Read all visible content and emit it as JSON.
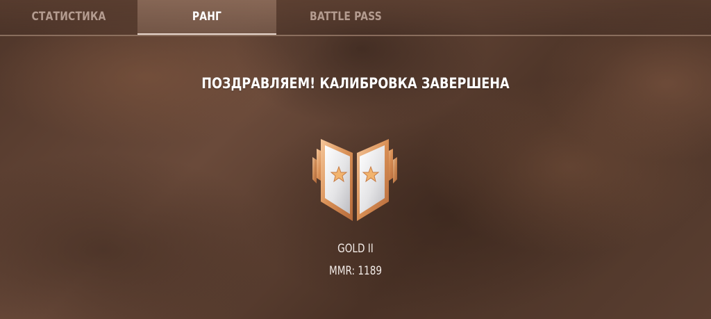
{
  "tabs": [
    {
      "label": "СТАТИСТИКА",
      "active": false
    },
    {
      "label": "РАНГ",
      "active": true
    },
    {
      "label": "BATTLE PASS",
      "active": false
    }
  ],
  "main": {
    "title": "ПОЗДРАВЛЯЕМ! КАЛИБРОВКА ЗАВЕРШЕНА",
    "rank_icon": "gold-rank-chevron-icon",
    "rank_name": "GOLD II",
    "mmr_label": "MMR:",
    "mmr_value": "1189"
  },
  "colors": {
    "accent": "#e3a56b",
    "tab_active_text": "#ffffff",
    "tab_inactive_text": "#b49c90"
  }
}
